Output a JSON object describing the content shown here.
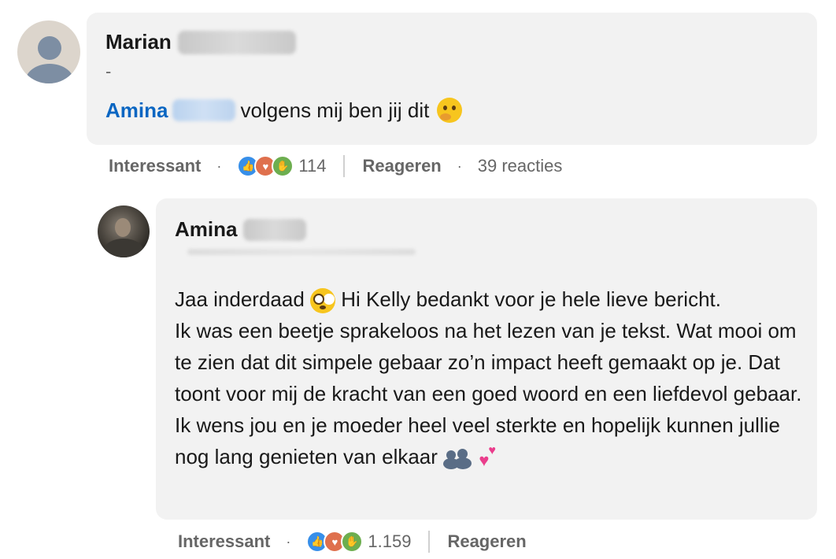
{
  "comment_1": {
    "author_first_name": "Marian",
    "headline": "-",
    "mention_name": "Amina",
    "text": "volgens mij ben jij dit",
    "emoji": "thinking-face",
    "actions": {
      "reaction_label": "Interessant",
      "reaction_icons": [
        "like-icon",
        "love-icon",
        "support-icon"
      ],
      "reaction_count": "114",
      "reply_label": "Reageren",
      "replies_count": "39 reacties"
    }
  },
  "comment_2": {
    "author_first_name": "Amina",
    "text_line_1_a": "Jaa inderdaad",
    "text_line_1_b": "Hi Kelly bedankt voor je hele lieve bericht.",
    "text_paragraph_1": "Ik was een beetje sprakeloos na het lezen van je tekst. Wat mooi om te zien dat dit simpele gebaar zo’n impact heeft gemaakt op je. Dat toont voor mij de kracht van een goed woord en een liefdevol gebaar.",
    "text_paragraph_2": "Ik wens jou en je moeder heel veel sterkte en hopelijk kunnen jullie nog lang genieten van elkaar",
    "emojis": [
      "flushed-face",
      "busts-in-silhouette",
      "two-hearts"
    ],
    "actions": {
      "reaction_label": "Interessant",
      "reaction_icons": [
        "like-icon",
        "love-icon",
        "support-icon"
      ],
      "reaction_count": "1.159",
      "reply_label": "Reageren"
    }
  }
}
